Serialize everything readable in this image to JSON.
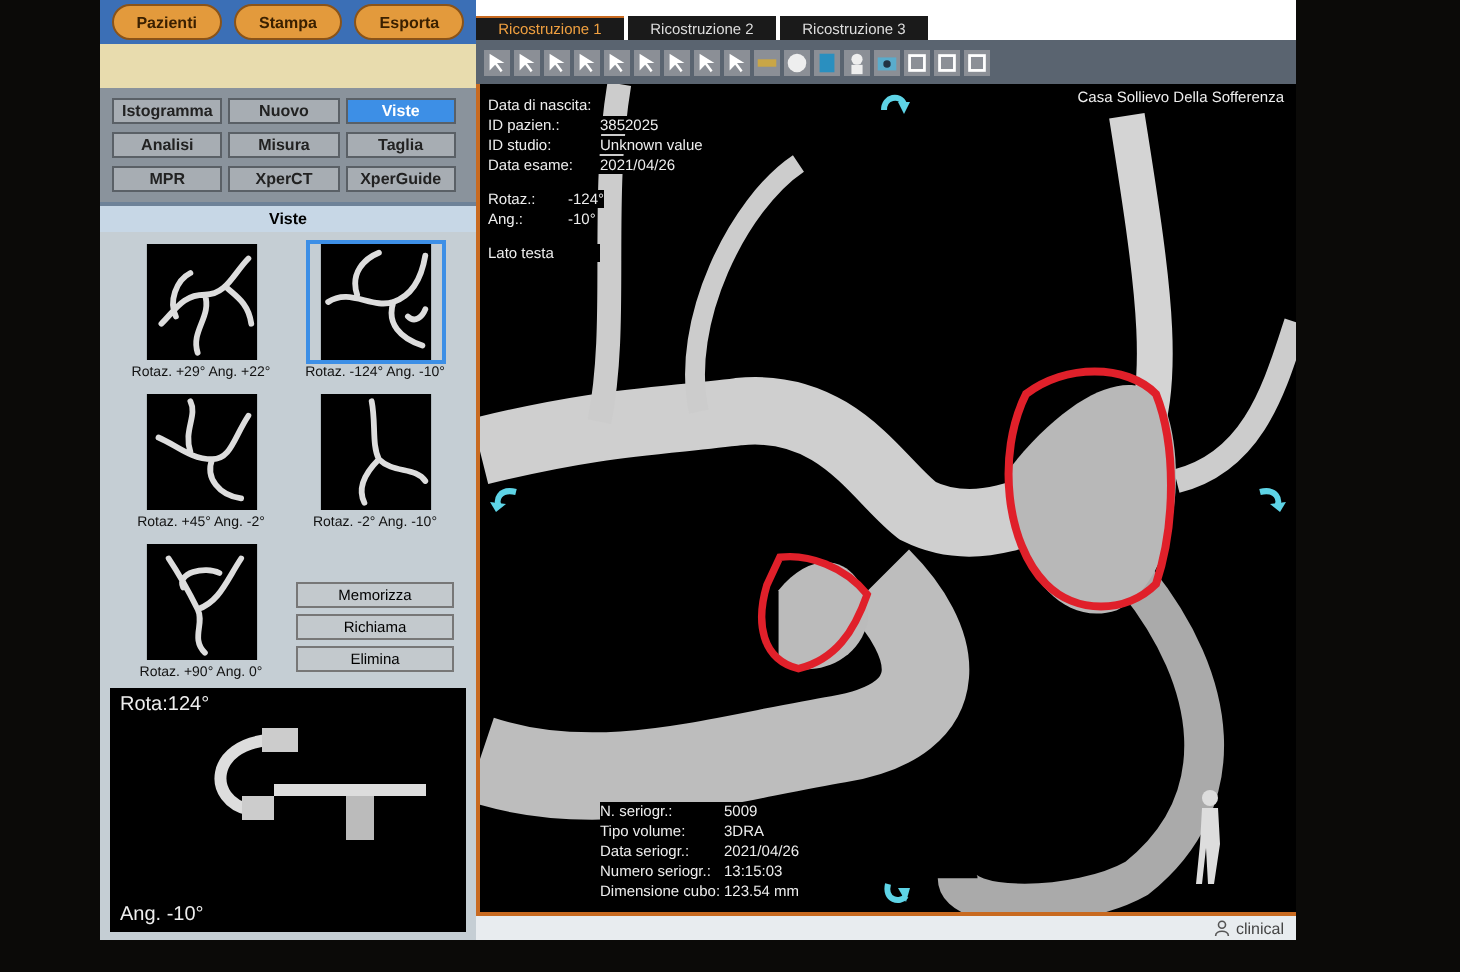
{
  "top_tabs": [
    {
      "label": "Pazienti"
    },
    {
      "label": "Stampa"
    },
    {
      "label": "Esporta"
    }
  ],
  "function_buttons": [
    {
      "label": "Istogramma",
      "selected": false
    },
    {
      "label": "Nuovo",
      "selected": false
    },
    {
      "label": "Viste",
      "selected": true
    },
    {
      "label": "Analisi",
      "selected": false
    },
    {
      "label": "Misura",
      "selected": false
    },
    {
      "label": "Taglia",
      "selected": false
    },
    {
      "label": "MPR",
      "selected": false
    },
    {
      "label": "XperCT",
      "selected": false
    },
    {
      "label": "XperGuide",
      "selected": false
    }
  ],
  "views_panel": {
    "title": "Viste",
    "views": [
      {
        "caption": "Rotaz. +29° Ang. +22°",
        "selected": false
      },
      {
        "caption": "Rotaz. -124° Ang. -10°",
        "selected": true
      },
      {
        "caption": "Rotaz. +45° Ang. -2°",
        "selected": false
      },
      {
        "caption": "Rotaz. -2° Ang. -10°",
        "selected": false
      },
      {
        "caption": "Rotaz. +90° Ang. 0°",
        "selected": false
      }
    ],
    "buttons": [
      "Memorizza",
      "Richiama",
      "Elimina"
    ]
  },
  "c_arm_preview": {
    "rotation": "Rota:124°",
    "angulation": "Ang. -10°"
  },
  "viewer": {
    "tabs": [
      {
        "label": "Ricostruzione 1",
        "selected": true
      },
      {
        "label": "Ricostruzione 2",
        "selected": false
      },
      {
        "label": "Ricostruzione 3",
        "selected": false
      }
    ],
    "institution": "Casa Sollievo Della Sofferenza",
    "patient_info": [
      {
        "label": "Data di nascita:"
      },
      {
        "label": "ID pazien.:",
        "value": "3852025"
      },
      {
        "label": "ID studio:",
        "value": "Unknown value"
      },
      {
        "label": "Data esame:",
        "value": "2021/04/26"
      }
    ],
    "angles": [
      {
        "label": "Rotaz.:",
        "value": "-124°"
      },
      {
        "label": "Ang.:",
        "value": "-10°"
      }
    ],
    "orientation": "Lato testa",
    "series_info": [
      {
        "label": "N. seriogr.:",
        "value": "5009"
      },
      {
        "label": "Tipo volume:",
        "value": "3DRA"
      },
      {
        "label": "Data seriogr.:",
        "value": "2021/04/26"
      },
      {
        "label": "Numero seriogr.:",
        "value": "13:15:03"
      },
      {
        "label": "Dimensione cubo:",
        "value": "123.54 mm"
      }
    ],
    "user": "clinical"
  }
}
